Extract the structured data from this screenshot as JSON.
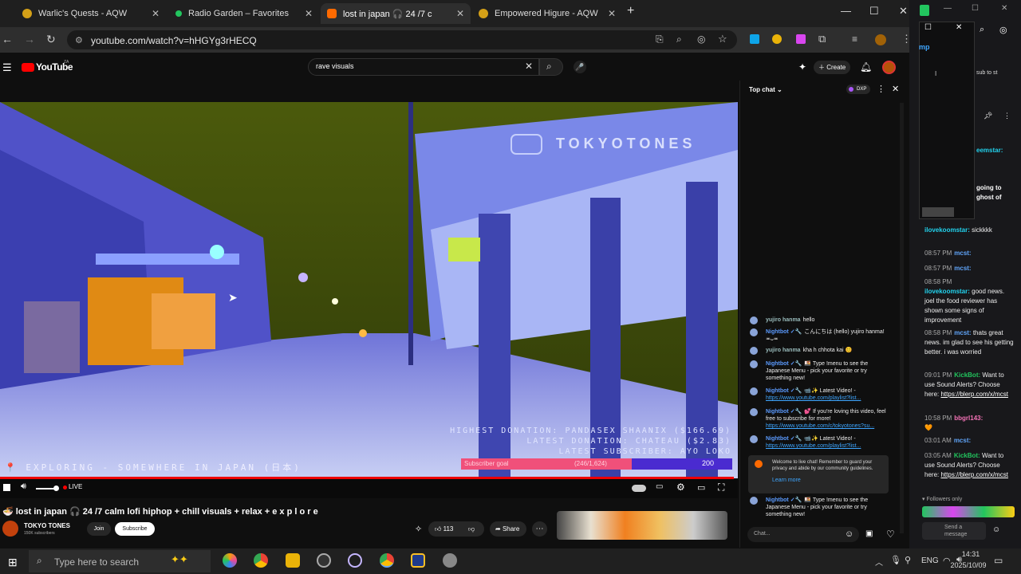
{
  "browser": {
    "tabs": [
      {
        "label": "Warlic's Quests - AQW",
        "color": "#d4a017"
      },
      {
        "label": "Radio Garden – Favorites",
        "color": "#22c55e"
      },
      {
        "label": "lost in japan 🎧 24 /7 c",
        "color": "#ff6a00"
      },
      {
        "label": "Empowered Higure - AQW",
        "color": "#d4a017"
      }
    ],
    "url": "youtube.com/watch?v=hHGYg3rHECQ"
  },
  "youtube": {
    "logo_text": "YouTube",
    "logo_sup": "ZA",
    "search_value": "rave visuals",
    "create_label": "Create"
  },
  "video": {
    "watermark": "TOKYOTONES",
    "highest_donation": "HIGHEST DONATION: PANDASEX SHAANIX ($166.69)",
    "latest_donation": "LATEST DONATION: CHATEAU ($2.83)",
    "latest_subscriber": "LATEST SUBSCRIBER: AYO LOKO",
    "exploring": "📍 EXPLORING - SOMEWHERE IN JAPAN (日本)",
    "sub_goal_label": "Subscriber goal",
    "sub_goal_count": "(246/1,624)",
    "sub_goal_target": "200",
    "sub_goal_fill": 0.63,
    "live_label": "LIVE"
  },
  "below": {
    "title": "🍜 lost in japan 🎧 24 /7 calm lofi hiphop + chill visuals + relax + e x p l o r e",
    "channel": "TOKYO TONES",
    "subs": "150K subscribers",
    "join": "Join",
    "subscribe": "Subscribe",
    "likes": "113",
    "share": "Share"
  },
  "chat": {
    "mode": "Top chat",
    "badge": "DXP",
    "input_placeholder": "Chat...",
    "welcome": "Welcome to live chat! Remember to guard your privacy and abide by our community guidelines.",
    "learn_more": "Learn more",
    "messages": [
      {
        "author": "yujiro hanma",
        "text": "hello",
        "link": ""
      },
      {
        "author": "Nightbot ✓🔧",
        "text": "こんにちは (hello) yujiro hanma! ≖ᴗ≖",
        "link": ""
      },
      {
        "author": "yujiro hanma",
        "text": "kha h chhota kai 😊",
        "link": ""
      },
      {
        "author": "Nightbot ✓🔧",
        "text": "🍱 Type !menu to see the Japanese Menu - pick your favorite or try something new!",
        "link": ""
      },
      {
        "author": "Nightbot ✓🔧",
        "text": "📹✨ Latest Video! - ",
        "link": "https://www.youtube.com/playlist?list..."
      },
      {
        "author": "Nightbot ✓🔧",
        "text": "💕 If you're loving this video, feel free to subscribe for more! ",
        "link": "https://www.youtube.com/c/tokyotones?su..."
      },
      {
        "author": "Nightbot ✓🔧",
        "text": "📹✨ Latest Video! - ",
        "link": "https://www.youtube.com/playlist?list..."
      },
      {
        "author": "Nightbot ✓🔧",
        "text": "🍱 Type !menu to see the Japanese Menu - pick your favorite or try something new!",
        "link": ""
      }
    ]
  },
  "side": {
    "header": "mp",
    "sub_text": "sub to st",
    "messages": [
      {
        "time": "",
        "user": "ilovekoomstar:",
        "user_color": "#22d3ee",
        "text": "sickkkk",
        "link": ""
      },
      {
        "time": "08:57 PM",
        "user": "mcst:",
        "user_color": "#60a5fa",
        "text": "",
        "link": ""
      },
      {
        "time": "08:57 PM",
        "user": "mcst:",
        "user_color": "#60a5fa",
        "text": "",
        "link": ""
      },
      {
        "time": "08:58 PM",
        "user": "ilovekoomstar:",
        "user_color": "#22d3ee",
        "text": "good news. joel the food reviewer has shown some signs of improvement",
        "link": ""
      },
      {
        "time": "08:58 PM",
        "user": "mcst:",
        "user_color": "#60a5fa",
        "text": "thats great news. im glad to see his getting better. i was worried",
        "link": ""
      },
      {
        "time": "09:01 PM",
        "user": "KickBot:",
        "user_color": "#22c55e",
        "text": "Want to use Sound Alerts? Choose here:",
        "link": "https://blerp.com/x/mcst"
      },
      {
        "time": "10:58 PM",
        "user": "bbgrl143:",
        "user_color": "#f472b6",
        "text": "🧡",
        "link": ""
      },
      {
        "time": "03:01 AM",
        "user": "mcst:",
        "user_color": "#60a5fa",
        "text": "",
        "link": ""
      },
      {
        "time": "03:05 AM",
        "user": "KickBot:",
        "user_color": "#22c55e",
        "text": "Want to use Sound Alerts? Choose here:",
        "link": "https://blerp.com/x/mcst"
      }
    ],
    "top_snippets": [
      "eemstar:",
      "going to ghost of"
    ],
    "followers_only": "Followers only",
    "send_message": "Send a message"
  },
  "taskbar": {
    "search_placeholder": "Type here to search",
    "lang": "ENG",
    "time": "14:31",
    "date": "2025/10/09"
  }
}
